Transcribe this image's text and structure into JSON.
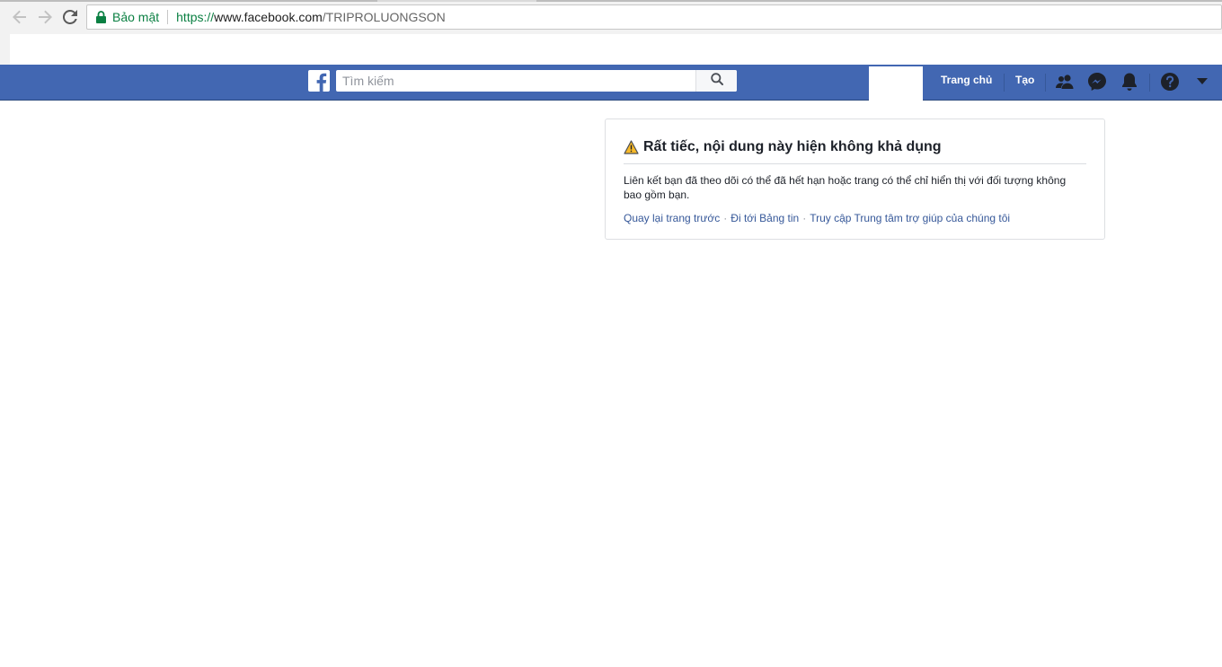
{
  "browser": {
    "secure_label": "Bảo mật",
    "url_scheme": "https://",
    "url_host": "www.facebook.com",
    "url_path": "/TRIPROLUONGSON",
    "icons": [
      "back-arrow-icon",
      "forward-arrow-icon",
      "reload-icon",
      "lock-icon"
    ]
  },
  "fb_header": {
    "brand_color": "#4267b2",
    "search": {
      "placeholder": "Tìm kiếm",
      "value": ""
    },
    "nav": {
      "home_label": "Trang chủ",
      "create_label": "Tạo"
    },
    "icons": [
      "facebook-logo-icon",
      "search-icon",
      "friend-requests-icon",
      "messenger-icon",
      "notifications-icon",
      "help-icon",
      "account-menu-caret-icon"
    ]
  },
  "error_card": {
    "title": "Rất tiếc, nội dung này hiện không khả dụng",
    "message": "Liên kết bạn đã theo dõi có thể đã hết hạn hoặc trang có thể chỉ hiển thị với đối tượng không bao gồm bạn.",
    "links": {
      "back": "Quay lại trang trước",
      "newsfeed": "Đi tới Bảng tin",
      "help_center": "Truy cập Trung tâm trợ giúp của chúng tôi"
    },
    "separator": "·",
    "warning_icon": "warning-triangle-icon"
  }
}
